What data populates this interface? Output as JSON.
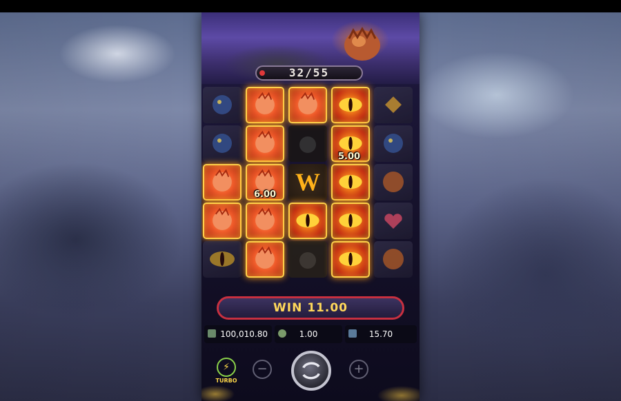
{
  "game": {
    "progress_counter": "32/55",
    "progress": 0.58,
    "win_label": "WIN 11.00"
  },
  "grid": {
    "columns": 6,
    "rows": 5,
    "cells": [
      [
        "blue-creature",
        "dragon",
        "dragon",
        "eye",
        "gem",
        null
      ],
      [
        "blue-creature",
        "dragon",
        "wild-dark",
        "eye",
        "blue-creature",
        null
      ],
      [
        "dragon",
        "dragon",
        "wild",
        "eye",
        "tiger",
        null
      ],
      [
        "dragon",
        "dragon",
        "eye",
        "eye",
        "heart",
        null
      ],
      [
        "eye",
        "dragon",
        "creature-dark",
        "eye",
        "tiger",
        null
      ]
    ],
    "multipliers": [
      {
        "label": "5.00"
      },
      {
        "label": "6.00"
      }
    ]
  },
  "info_bar": {
    "balance": "100,010.80",
    "bet": "1.00",
    "win": "15.70"
  },
  "controls": {
    "turbo_label": "TURBO",
    "minus_label": "−",
    "plus_label": "+"
  },
  "colors": {
    "win_border": "#c83040",
    "win_text": "#ffd85a",
    "highlight": "#ffd04a",
    "counter_fill": "#e0383a"
  },
  "icons": [
    "egg-icon",
    "eye-symbol-icon",
    "dragon-symbol-icon",
    "wild-symbol-icon",
    "wallet-icon",
    "coin-stack-icon",
    "win-icon",
    "turbo-icon",
    "minus-icon",
    "plus-icon",
    "spin-icon"
  ]
}
